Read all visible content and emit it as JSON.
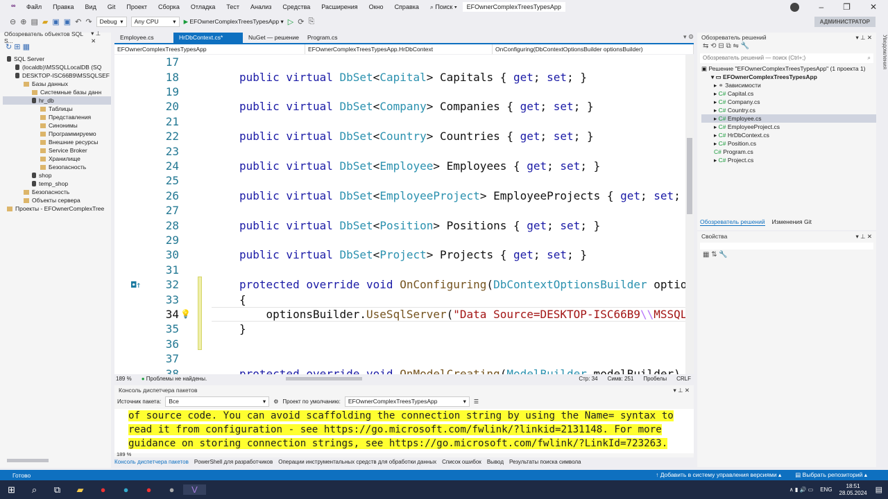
{
  "menu": {
    "items": [
      "Файл",
      "Правка",
      "Вид",
      "Git",
      "Проект",
      "Сборка",
      "Отладка",
      "Тест",
      "Анализ",
      "Средства",
      "Расширения",
      "Окно",
      "Справка"
    ],
    "search": "Поиск",
    "title": "EFOwnerComplexTreesTypesApp"
  },
  "toolbar": {
    "config": "Debug",
    "platform": "Any CPU",
    "run_target": "EFOwnerComplexTreesTypesApp",
    "admin": "АДМИНИСТРАТОР"
  },
  "sql_explorer": {
    "title": "Обозреватель объектов SQL S...",
    "tree": [
      {
        "label": "SQL Server",
        "depth": 0,
        "icon": "server"
      },
      {
        "label": "(localdb)\\MSSQLLocalDB (SQ",
        "depth": 1,
        "icon": "server"
      },
      {
        "label": "DESKTOP-ISC66B9\\MSSQLSEF",
        "depth": 1,
        "icon": "server"
      },
      {
        "label": "Базы данных",
        "depth": 2,
        "icon": "folder"
      },
      {
        "label": "Системные базы данн",
        "depth": 3,
        "icon": "folder"
      },
      {
        "label": "hr_db",
        "depth": 3,
        "icon": "db",
        "selected": true
      },
      {
        "label": "Таблицы",
        "depth": 4,
        "icon": "folder"
      },
      {
        "label": "Представления",
        "depth": 4,
        "icon": "folder"
      },
      {
        "label": "Синонимы",
        "depth": 4,
        "icon": "folder"
      },
      {
        "label": "Программируемо",
        "depth": 4,
        "icon": "folder"
      },
      {
        "label": "Внешние ресурсы",
        "depth": 4,
        "icon": "folder"
      },
      {
        "label": "Service Broker",
        "depth": 4,
        "icon": "folder"
      },
      {
        "label": "Хранилище",
        "depth": 4,
        "icon": "folder"
      },
      {
        "label": "Безопасность",
        "depth": 4,
        "icon": "folder"
      },
      {
        "label": "shop",
        "depth": 3,
        "icon": "db"
      },
      {
        "label": "temp_shop",
        "depth": 3,
        "icon": "db"
      },
      {
        "label": "Безопасность",
        "depth": 2,
        "icon": "folder"
      },
      {
        "label": "Объекты сервера",
        "depth": 2,
        "icon": "folder"
      },
      {
        "label": "Проекты - EFOwnerComplexTree",
        "depth": 0,
        "icon": "folder"
      }
    ]
  },
  "editor": {
    "tabs": [
      "Employee.cs",
      "HrDbContext.cs*",
      "NuGet — решение",
      "Program.cs"
    ],
    "nav": {
      "project": "EFOwnerComplexTreesTypesApp",
      "class": "EFOwnerComplexTreesTypesApp.HrDbContext",
      "member": "OnConfiguring(DbContextOptionsBuilder optionsBuilder)"
    },
    "current_line": 34,
    "lines": [
      {
        "n": 17,
        "tokens": []
      },
      {
        "n": 18,
        "tokens": [
          [
            "k",
            "public virtual "
          ],
          [
            "t",
            "DbSet"
          ],
          [
            "p",
            "<"
          ],
          [
            "t",
            "Capital"
          ],
          [
            "p",
            "> Capitals { "
          ],
          [
            "k",
            "get"
          ],
          [
            "p",
            "; "
          ],
          [
            "k",
            "set"
          ],
          [
            "p",
            "; }"
          ]
        ]
      },
      {
        "n": 19,
        "tokens": []
      },
      {
        "n": 20,
        "tokens": [
          [
            "k",
            "public virtual "
          ],
          [
            "t",
            "DbSet"
          ],
          [
            "p",
            "<"
          ],
          [
            "t",
            "Company"
          ],
          [
            "p",
            "> Companies { "
          ],
          [
            "k",
            "get"
          ],
          [
            "p",
            "; "
          ],
          [
            "k",
            "set"
          ],
          [
            "p",
            "; }"
          ]
        ]
      },
      {
        "n": 21,
        "tokens": []
      },
      {
        "n": 22,
        "tokens": [
          [
            "k",
            "public virtual "
          ],
          [
            "t",
            "DbSet"
          ],
          [
            "p",
            "<"
          ],
          [
            "t",
            "Country"
          ],
          [
            "p",
            "> Countries { "
          ],
          [
            "k",
            "get"
          ],
          [
            "p",
            "; "
          ],
          [
            "k",
            "set"
          ],
          [
            "p",
            "; }"
          ]
        ]
      },
      {
        "n": 23,
        "tokens": []
      },
      {
        "n": 24,
        "tokens": [
          [
            "k",
            "public virtual "
          ],
          [
            "t",
            "DbSet"
          ],
          [
            "p",
            "<"
          ],
          [
            "t",
            "Employee"
          ],
          [
            "p",
            "> Employees { "
          ],
          [
            "k",
            "get"
          ],
          [
            "p",
            "; "
          ],
          [
            "k",
            "set"
          ],
          [
            "p",
            "; }"
          ]
        ]
      },
      {
        "n": 25,
        "tokens": []
      },
      {
        "n": 26,
        "tokens": [
          [
            "k",
            "public virtual "
          ],
          [
            "t",
            "DbSet"
          ],
          [
            "p",
            "<"
          ],
          [
            "t",
            "EmployeeProject"
          ],
          [
            "p",
            "> EmployeeProjects { "
          ],
          [
            "k",
            "get"
          ],
          [
            "p",
            "; "
          ],
          [
            "k",
            "set"
          ],
          [
            "p",
            ";"
          ]
        ]
      },
      {
        "n": 27,
        "tokens": []
      },
      {
        "n": 28,
        "tokens": [
          [
            "k",
            "public virtual "
          ],
          [
            "t",
            "DbSet"
          ],
          [
            "p",
            "<"
          ],
          [
            "t",
            "Position"
          ],
          [
            "p",
            "> Positions { "
          ],
          [
            "k",
            "get"
          ],
          [
            "p",
            "; "
          ],
          [
            "k",
            "set"
          ],
          [
            "p",
            "; }"
          ]
        ]
      },
      {
        "n": 29,
        "tokens": []
      },
      {
        "n": 30,
        "tokens": [
          [
            "k",
            "public virtual "
          ],
          [
            "t",
            "DbSet"
          ],
          [
            "p",
            "<"
          ],
          [
            "t",
            "Project"
          ],
          [
            "p",
            "> Projects { "
          ],
          [
            "k",
            "get"
          ],
          [
            "p",
            "; "
          ],
          [
            "k",
            "set"
          ],
          [
            "p",
            "; }"
          ]
        ]
      },
      {
        "n": 31,
        "tokens": []
      },
      {
        "n": 32,
        "tokens": [
          [
            "k",
            "protected override void "
          ],
          [
            "m",
            "OnConfiguring"
          ],
          [
            "p",
            "("
          ],
          [
            "t",
            "DbContextOptionsBuilder"
          ],
          [
            "p",
            " optio"
          ]
        ]
      },
      {
        "n": 33,
        "tokens": [
          [
            "p",
            "{"
          ]
        ]
      },
      {
        "n": 34,
        "tokens": [
          [
            "p",
            "    optionsBuilder."
          ],
          [
            "m",
            "UseSqlServer"
          ],
          [
            "p",
            "("
          ],
          [
            "s",
            "\"Data Source=DESKTOP-ISC66B9"
          ],
          [
            "e",
            "\\\\"
          ],
          [
            "s",
            "MSSQL"
          ]
        ]
      },
      {
        "n": 35,
        "tokens": [
          [
            "p",
            "}"
          ]
        ]
      },
      {
        "n": 36,
        "tokens": []
      },
      {
        "n": 37,
        "tokens": []
      },
      {
        "n": 38,
        "tokens": [
          [
            "k",
            "protected override void "
          ],
          [
            "m",
            "OnModelCreating"
          ],
          [
            "p",
            "("
          ],
          [
            "t",
            "ModelBuilder"
          ],
          [
            "p",
            " modelBuilder)"
          ]
        ]
      }
    ],
    "status": {
      "zoom": "189 %",
      "problems": "Проблемы не найдены.",
      "line": "Стр: 34",
      "col": "Симв: 251",
      "spaces": "Пробелы",
      "eol": "CRLF"
    }
  },
  "console": {
    "title": "Консоль диспетчера пакетов",
    "source_label": "Источник пакета:",
    "source": "Все",
    "project_label": "Проект по умолчанию:",
    "project": "EFOwnerComplexTreesTypesApp",
    "lines": [
      "of source code. You can avoid scaffolding the connection string by using the Name= syntax to",
      "read it from configuration - see https://go.microsoft.com/fwlink/?linkid=2131148. For more",
      "guidance on storing connection strings, see https://go.microsoft.com/fwlink/?LinkId=723263."
    ],
    "zoom": "189 %"
  },
  "bottom_tabs": [
    "Консоль диспетчера пакетов",
    "PowerShell для разработчиков",
    "Операции инструментальных средств для обработки данных",
    "Список ошибок",
    "Вывод",
    "Результаты поиска символа"
  ],
  "solution": {
    "title": "Обозреватель решений",
    "search_placeholder": "Обозреватель решений — поиск (Ctrl+;)",
    "solution_label": "Решение \"EFOwnerComplexTreesTypesApp\" (1 проекта 1)",
    "project": "EFOwnerComplexTreesTypesApp",
    "items": [
      "Зависимости",
      "Capital.cs",
      "Company.cs",
      "Country.cs",
      "Employee.cs",
      "EmployeeProject.cs",
      "HrDbContext.cs",
      "Position.cs",
      "Program.cs",
      "Project.cs"
    ],
    "selected": "Employee.cs",
    "tabs": [
      "Обозреватель решений",
      "Изменения Git"
    ],
    "properties_title": "Свойства",
    "notifications": "Уведомления"
  },
  "statusbar": {
    "ready": "Готово",
    "add_vcs": "Добавить в систему управления версиями",
    "repo": "Выбрать репозиторий"
  },
  "taskbar": {
    "lang": "ENG",
    "time": "18:51",
    "date": "28.05.2024"
  }
}
